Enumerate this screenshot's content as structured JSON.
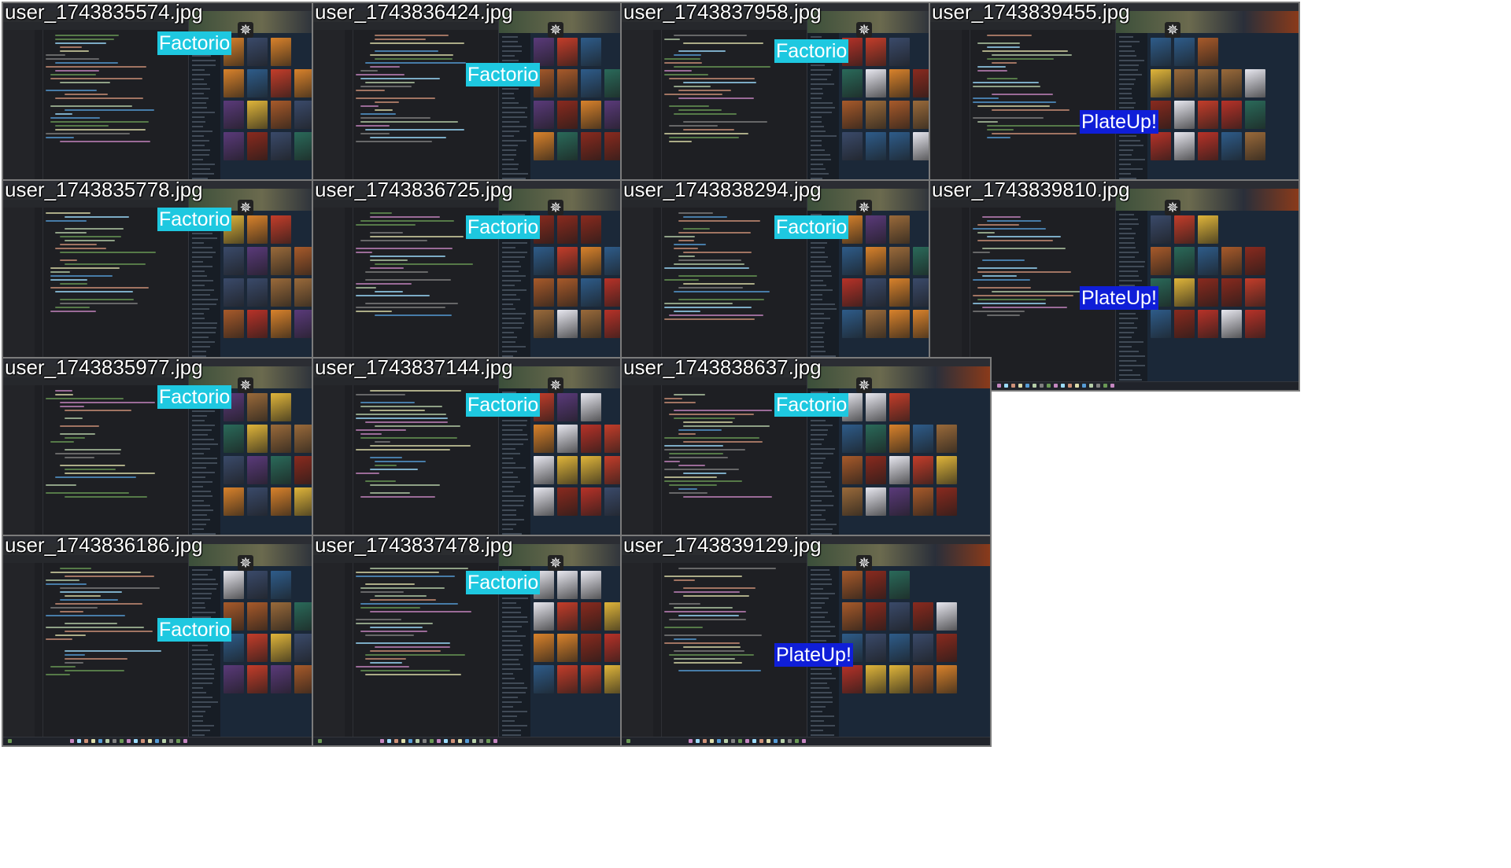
{
  "colors": {
    "factorio_bg": "#1ec8e0",
    "plateup_bg": "#0f1ed8",
    "tile_border": "#7b7b7b"
  },
  "tiles": [
    {
      "filename": "user_1743835574.jpg",
      "label": "Factorio"
    },
    {
      "filename": "user_1743836424.jpg",
      "label": "Factorio"
    },
    {
      "filename": "user_1743837958.jpg",
      "label": "Factorio"
    },
    {
      "filename": "user_1743839455.jpg",
      "label": "PlateUp!"
    },
    {
      "filename": "user_1743835778.jpg",
      "label": "Factorio"
    },
    {
      "filename": "user_1743836725.jpg",
      "label": "Factorio"
    },
    {
      "filename": "user_1743838294.jpg",
      "label": "Factorio"
    },
    {
      "filename": "user_1743839810.jpg",
      "label": "PlateUp!"
    },
    {
      "filename": "user_1743835977.jpg",
      "label": "Factorio"
    },
    {
      "filename": "user_1743837144.jpg",
      "label": "Factorio"
    },
    {
      "filename": "user_1743838637.jpg",
      "label": "Factorio"
    },
    {
      "filename": "user_1743836186.jpg",
      "label": "Factorio"
    },
    {
      "filename": "user_1743837478.jpg",
      "label": "Factorio"
    },
    {
      "filename": "user_1743839129.jpg",
      "label": "PlateUp!"
    }
  ]
}
